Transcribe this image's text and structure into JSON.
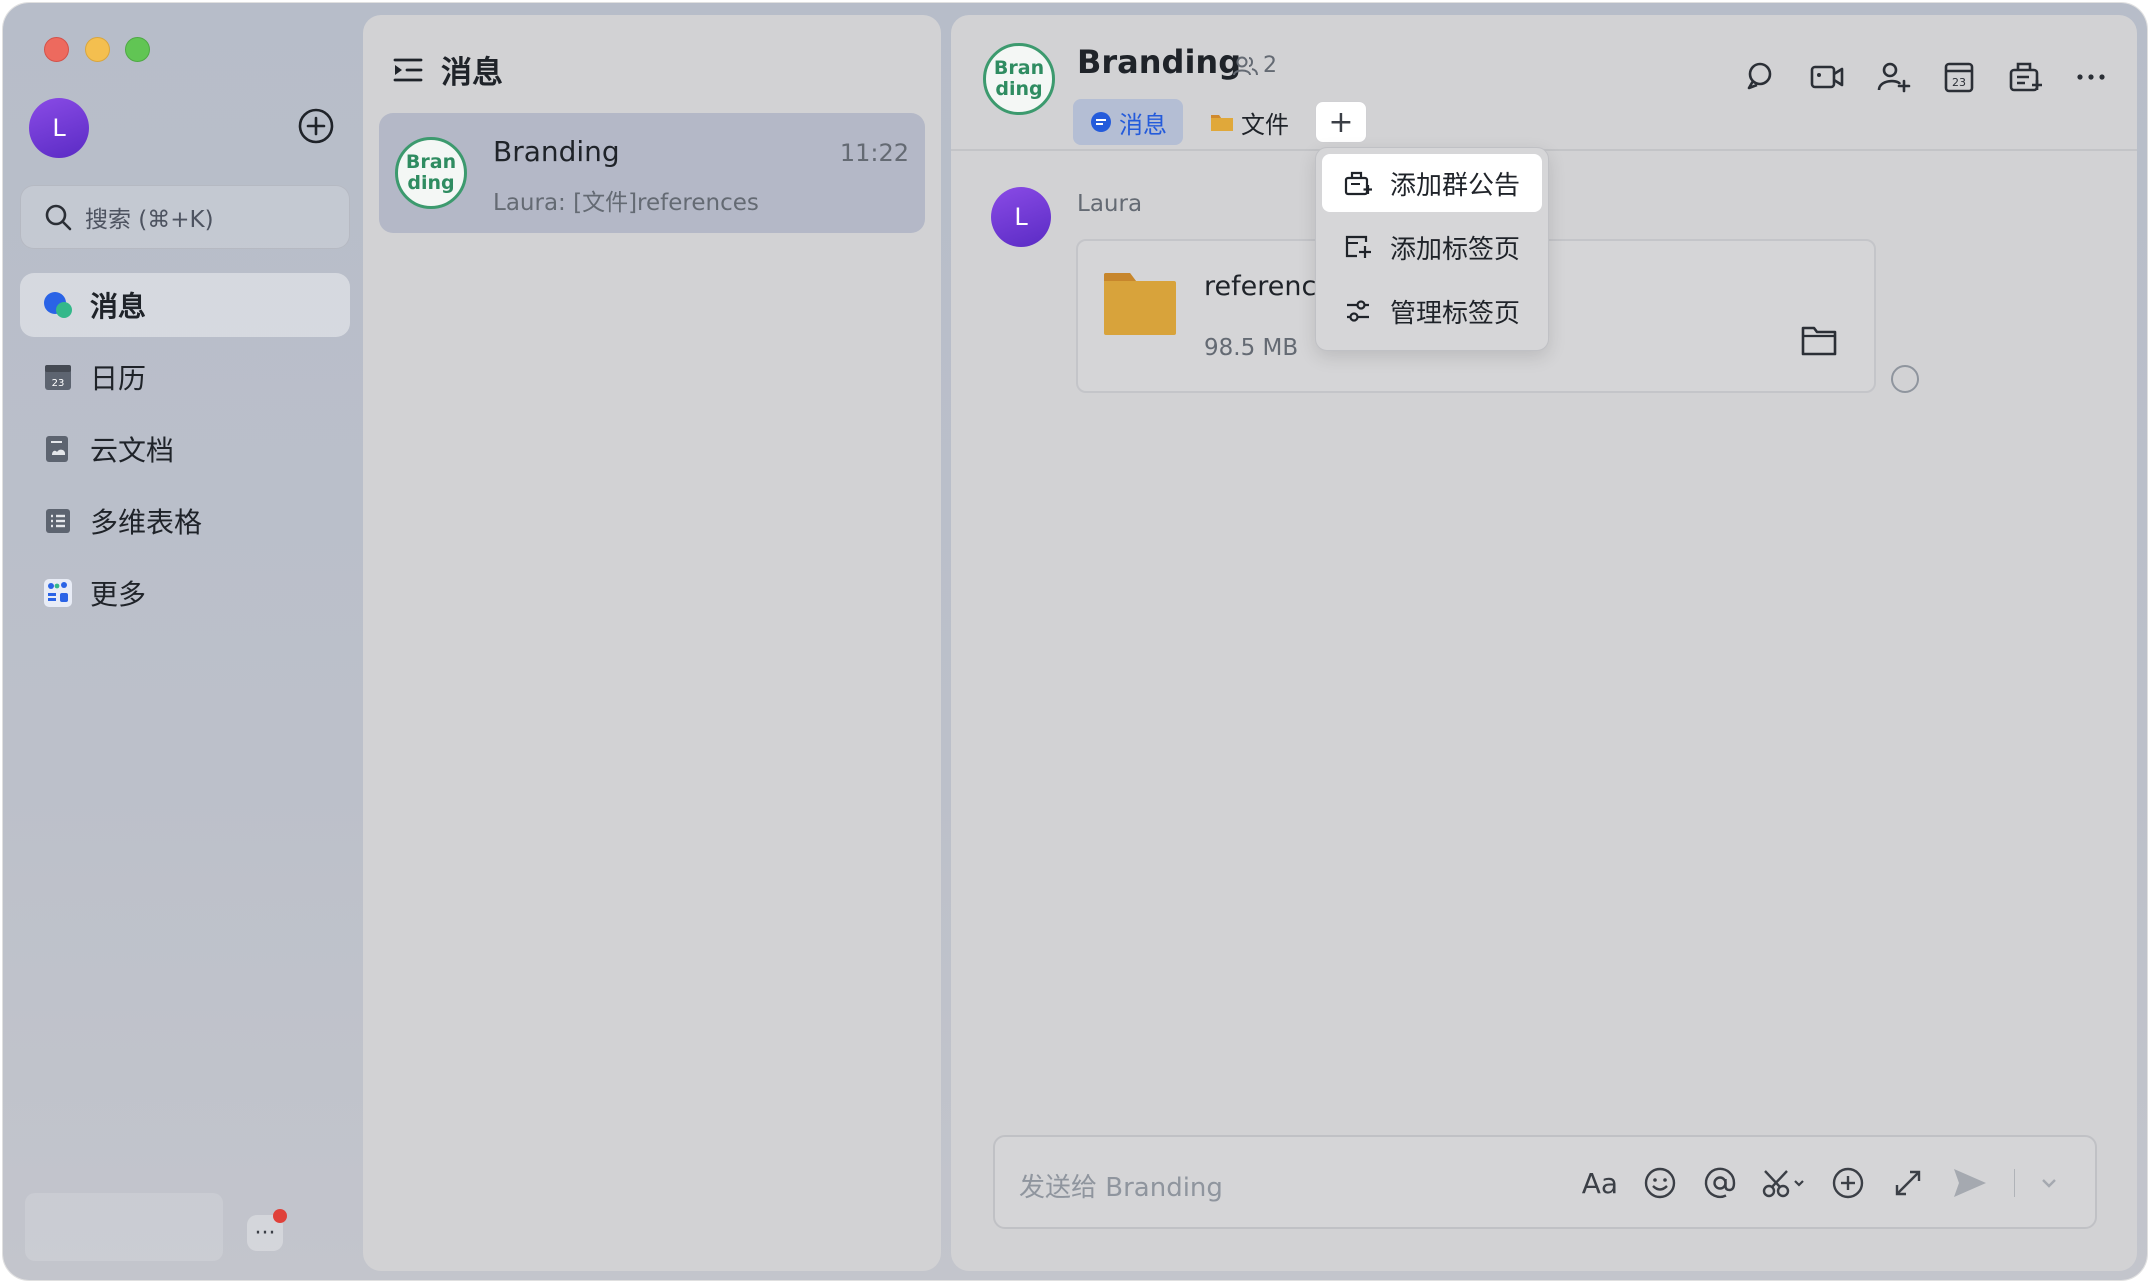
{
  "sidebar": {
    "user_initial": "L",
    "search_placeholder": "搜索 (⌘+K)",
    "nav_items": [
      {
        "label": "消息",
        "icon": "chat-bubbles-icon",
        "active": true
      },
      {
        "label": "日历",
        "icon": "calendar-icon",
        "active": false
      },
      {
        "label": "云文档",
        "icon": "cloud-doc-icon",
        "active": false
      },
      {
        "label": "多维表格",
        "icon": "base-table-icon",
        "active": false
      },
      {
        "label": "更多",
        "icon": "apps-grid-icon",
        "active": false
      }
    ],
    "more_label": "···"
  },
  "list": {
    "header_title": "消息",
    "conversations": [
      {
        "avatar_text": "Bran\nding",
        "name": "Branding",
        "time": "11:22",
        "preview": "Laura: [文件]references"
      }
    ]
  },
  "chat": {
    "avatar_text": "Bran\nding",
    "title": "Branding",
    "member_count": "2",
    "tabs": [
      {
        "label": "消息",
        "icon": "chat-bubble-icon",
        "active": true
      },
      {
        "label": "文件",
        "icon": "folder-icon",
        "active": false
      }
    ],
    "tab_add": "+",
    "header_icons": [
      "search-icon",
      "video-call-icon",
      "add-member-icon",
      "calendar-icon",
      "announcement-icon",
      "more-icon"
    ],
    "messages": [
      {
        "sender": "Laura",
        "sender_initial": "L",
        "file_name": "reference",
        "file_size": "98.5 MB"
      }
    ],
    "composer_placeholder": "发送给 Branding",
    "composer_format": "Aa"
  },
  "dropdown": {
    "items": [
      {
        "label": "添加群公告",
        "icon": "announcement-add-icon",
        "highlighted": true
      },
      {
        "label": "添加标签页",
        "icon": "tab-add-icon",
        "highlighted": false
      },
      {
        "label": "管理标签页",
        "icon": "sliders-icon",
        "highlighted": false
      }
    ]
  },
  "colors": {
    "accent": "#245bdb",
    "group_avatar": "#3c9a6e",
    "avatar_purple": "#6d35d6",
    "folder": "#e0a83a"
  }
}
